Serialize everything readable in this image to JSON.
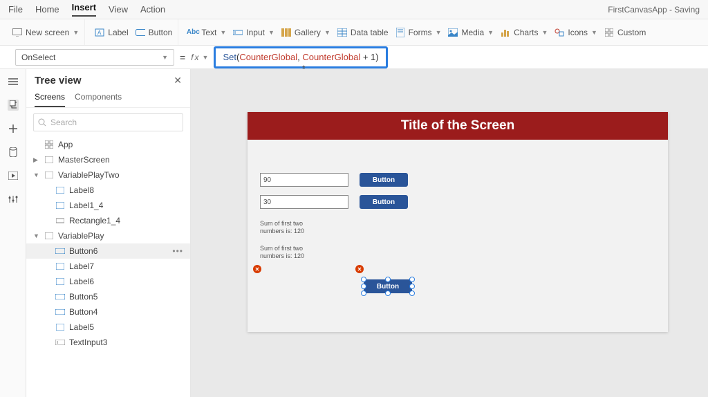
{
  "app_title": "FirstCanvasApp - Saving",
  "menubar": {
    "file": "File",
    "home": "Home",
    "insert": "Insert",
    "view": "View",
    "action": "Action"
  },
  "ribbon": {
    "new_screen": "New screen",
    "label": "Label",
    "button": "Button",
    "text": "Text",
    "input": "Input",
    "gallery": "Gallery",
    "data_table": "Data table",
    "forms": "Forms",
    "media": "Media",
    "charts": "Charts",
    "icons": "Icons",
    "custom": "Custom"
  },
  "property_dropdown": "OnSelect",
  "formula_display": "Set(CounterGlobal, CounterGlobal + 1)",
  "formula_tokens": {
    "fn": "Set",
    "v1": "CounterGlobal",
    "v2": "CounterGlobal",
    "num": "1"
  },
  "tree": {
    "title": "Tree view",
    "tabs": {
      "screens": "Screens",
      "components": "Components"
    },
    "search_placeholder": "Search",
    "nodes": {
      "app": "App",
      "master": "MasterScreen",
      "vptwo": "VariablePlayTwo",
      "label8": "Label8",
      "label1_4": "Label1_4",
      "rect1_4": "Rectangle1_4",
      "vp": "VariablePlay",
      "button6": "Button6",
      "label7": "Label7",
      "label6": "Label6",
      "button5": "Button5",
      "button4": "Button4",
      "label5": "Label5",
      "textinput3": "TextInput3"
    }
  },
  "canvas": {
    "screen_title": "Title of the Screen",
    "input1": "90",
    "input2": "30",
    "button_label": "Button",
    "sum_label_1": "Sum of first two\nnumbers is: 120",
    "sum_label_2": "Sum of first two\nnumbers is: 120"
  }
}
